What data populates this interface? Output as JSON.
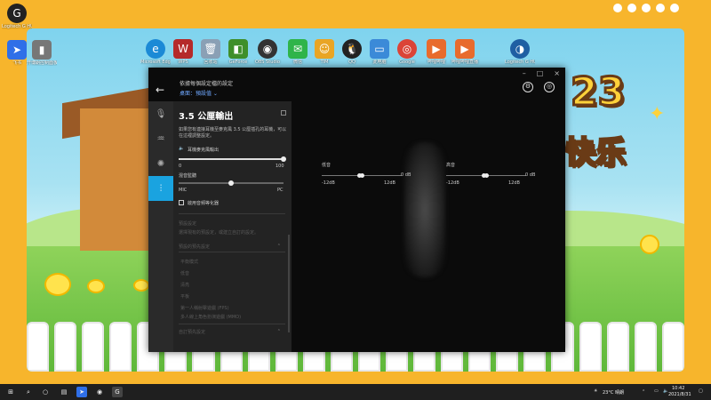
{
  "desktop": {
    "icons": [
      {
        "label": "Logitech G HUB",
        "color": "#222222",
        "glyph": "G"
      },
      {
        "label": "飞书",
        "color": "#2f6fe8",
        "glyph": "➤"
      },
      {
        "label": "开博朗控制面板",
        "color": "#777777",
        "glyph": "▮"
      },
      {
        "label": "Microsoft Edge",
        "color": "#1b8ad6",
        "glyph": "e"
      },
      {
        "label": "WPS",
        "color": "#b52a2a",
        "glyph": "W"
      },
      {
        "label": "回收站",
        "color": "#8aa0b5",
        "glyph": "🗑"
      },
      {
        "label": "GeForce",
        "color": "#3f8f2a",
        "glyph": "◧"
      },
      {
        "label": "OBS Studio",
        "color": "#333333",
        "glyph": "◉"
      },
      {
        "label": "微信",
        "color": "#2fb44a",
        "glyph": "✉"
      },
      {
        "label": "TIM",
        "color": "#e9a525",
        "glyph": "☺"
      },
      {
        "label": "QQ",
        "color": "#222222",
        "glyph": "🐧"
      },
      {
        "label": "此电脑",
        "color": "#3b8ad8",
        "glyph": "▭"
      },
      {
        "label": "Google",
        "color": "#db4437",
        "glyph": "◎"
      },
      {
        "label": "哔哩哔哩",
        "color": "#e86b2d",
        "glyph": "▶"
      },
      {
        "label": "哔哩哔哩直播",
        "color": "#e86b2d",
        "glyph": "▶"
      },
      {
        "label": "Logitech G HUB",
        "color": "#1f5fa3",
        "glyph": "◑"
      }
    ]
  },
  "wallpaper": {
    "big_number": "23",
    "big_word": "快乐"
  },
  "window": {
    "controls": {
      "min": "–",
      "max": "□",
      "close": "×"
    },
    "back_glyph": "←",
    "header_title": "依據每個設定檔的設定",
    "header_subtitle": "桌面：預設值 ⌄",
    "icons": {
      "settings": "⚙",
      "account": "◎"
    }
  },
  "rail": {
    "items": [
      {
        "name": "microphone",
        "glyph": "🎙"
      },
      {
        "name": "waveform",
        "glyph": "♒"
      },
      {
        "name": "lighting",
        "glyph": "✺"
      },
      {
        "name": "equalizer",
        "glyph": "⫶"
      }
    ]
  },
  "panel": {
    "title": "3.5 公厘輸出",
    "description": "如果您有連接耳機至麥克風 3.5 公厘插孔的耳機，可以在這裡調整設定。",
    "headphone_volume_label": "耳機麥克風輸出",
    "volume_min": "0",
    "volume_max": "100",
    "volume_level": 1.0,
    "mix_label": "混音監聽",
    "mix_left": "MIC",
    "mix_right": "PC",
    "mix_level": 0.5,
    "eq_checkbox_label": "啟用音頻等化器",
    "eq_checked": false,
    "preset_section_title": "預設設定",
    "preset_desc": "選擇現有的預設定，或建立自訂的設定。",
    "preset_group_label": "預設的預先設定",
    "preset_items": [
      "平衡模式",
      "低音",
      "清亮",
      "平板",
      "第一人稱射擊遊戲 (FPS)",
      "多人線上角色扮演遊戲 (MMO)"
    ],
    "custom_group_label": "自訂預先設定"
  },
  "eq": {
    "left": {
      "label": "低音",
      "min": "-12dB",
      "max": "12dB",
      "value_label": "0 dB",
      "value_db": 0
    },
    "right": {
      "label": "高音",
      "min": "-12dB",
      "max": "12dB",
      "value_label": "0 dB",
      "value_db": 0
    }
  },
  "taskbar": {
    "weather": "23°C 晴朗",
    "time": "10:42",
    "date": "2021/8/31"
  }
}
